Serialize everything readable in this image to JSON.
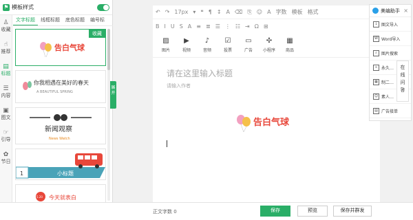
{
  "panel": {
    "title": "模板样式"
  },
  "categories": [
    {
      "label": "收藏",
      "icon": "person-icon"
    },
    {
      "label": "推荐",
      "icon": "thumb-up-icon"
    },
    {
      "label": "标题",
      "icon": "title-icon"
    },
    {
      "label": "内容",
      "icon": "content-icon"
    },
    {
      "label": "图文",
      "icon": "image-text-icon"
    },
    {
      "label": "引导",
      "icon": "guide-icon"
    },
    {
      "label": "节日",
      "icon": "festival-icon"
    }
  ],
  "sub_tabs": [
    "文字标题",
    "线框标题",
    "底色标题",
    "编号标"
  ],
  "cards": {
    "collect_badge": "收藏",
    "card1_text": "告白气球",
    "card2_text": "你我相遇在美好的春天",
    "card2_sub": "A BEAUTIFUL SPRING",
    "card3_text": "新闻观察",
    "card3_sub": "News Watch",
    "card4_num": "1",
    "card4_text": "小标题",
    "card5_badge": "5.20",
    "card5_text": "今天就表白"
  },
  "expand_label": "展开",
  "toolbar": {
    "font_size": "17px",
    "row1": [
      "↶",
      "↷",
      "17px",
      "▾",
      "❝",
      "¶",
      "↕",
      "A",
      "⌫",
      "⎘",
      "☺",
      "A",
      "字数",
      "模板",
      "格式"
    ],
    "row2": [
      "B",
      "I",
      "U",
      "S",
      "A",
      "≡",
      "≣",
      "☰",
      "⋮",
      "☷",
      "⇥",
      "Ω",
      "⊞"
    ]
  },
  "insert": [
    {
      "label": "图片",
      "icon": "image-icon"
    },
    {
      "label": "视频",
      "icon": "video-icon"
    },
    {
      "label": "音频",
      "icon": "audio-icon"
    },
    {
      "label": "投票",
      "icon": "vote-icon"
    },
    {
      "label": "广告",
      "icon": "ad-icon"
    },
    {
      "label": "小程序",
      "icon": "mini-program-icon"
    },
    {
      "label": "商品",
      "icon": "goods-icon"
    }
  ],
  "editor": {
    "title_placeholder": "请在这里输入标题",
    "author_placeholder": "请输入作者",
    "content_logo": "告白气球"
  },
  "helper": {
    "title": "美编助手",
    "items": [
      {
        "label": "图文导入",
        "icon": "import-icon"
      },
      {
        "label": "Word导入",
        "icon": "word-icon"
      },
      {
        "label": "图片搜索",
        "icon": "image-search-icon"
      },
      {
        "label": "永久…",
        "icon": "link-icon"
      },
      {
        "label": "制二…",
        "icon": "qrcode-icon"
      },
      {
        "label": "素人…",
        "icon": "user-icon"
      },
      {
        "label": "广告接单",
        "icon": "ad-order-icon"
      }
    ],
    "online_qa": "在线问答"
  },
  "footer": {
    "word_count": "正文字数 0",
    "save": "保存",
    "preview": "预览",
    "publish": "保存并群发"
  },
  "colors": {
    "accent": "#2aae67",
    "brand_red": "#e8473a",
    "helper_blue": "#2aa0e8"
  }
}
